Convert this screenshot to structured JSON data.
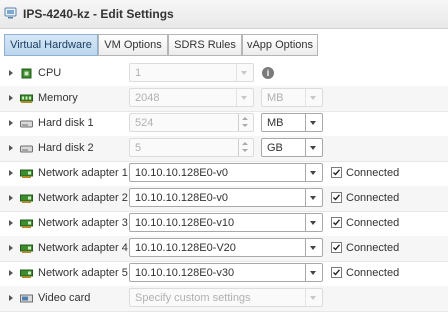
{
  "window": {
    "title": "IPS-4240-kz - Edit Settings"
  },
  "tabs": [
    {
      "label": "Virtual Hardware",
      "active": true
    },
    {
      "label": "VM Options",
      "active": false
    },
    {
      "label": "SDRS Rules",
      "active": false
    },
    {
      "label": "vApp Options",
      "active": false
    }
  ],
  "devices": {
    "cpu": {
      "label": "CPU",
      "value": "1"
    },
    "memory": {
      "label": "Memory",
      "value": "2048",
      "unit": "MB"
    },
    "hard_disk_1": {
      "label": "Hard disk 1",
      "value": "524",
      "unit": "MB"
    },
    "hard_disk_2": {
      "label": "Hard disk 2",
      "value": "5",
      "unit": "GB"
    },
    "network_adapters": [
      {
        "label": "Network adapter 1",
        "network": "10.10.10.128E0-v0",
        "connected_label": "Connected",
        "connected": true
      },
      {
        "label": "Network adapter 2",
        "network": "10.10.10.128E0-v0",
        "connected_label": "Connected",
        "connected": true
      },
      {
        "label": "Network adapter 3",
        "network": "10.10.10.128E0-v10",
        "connected_label": "Connected",
        "connected": true
      },
      {
        "label": "Network adapter 4",
        "network": "10.10.10.128E0-V20",
        "connected_label": "Connected",
        "connected": true
      },
      {
        "label": "Network adapter 5",
        "network": "10.10.10.128E0-v30",
        "connected_label": "Connected",
        "connected": true
      }
    ],
    "video_card": {
      "label": "Video card",
      "value": "Specify custom settings"
    }
  },
  "icons": {
    "cpu": "cpu-chip-icon",
    "memory": "memory-module-icon",
    "disk": "hard-disk-icon",
    "network": "network-card-icon",
    "video": "video-card-icon"
  },
  "colors": {
    "accent": "#bcd6ee",
    "tab_active_text": "#1d3f63",
    "nic_green": "#3b8d2e"
  }
}
